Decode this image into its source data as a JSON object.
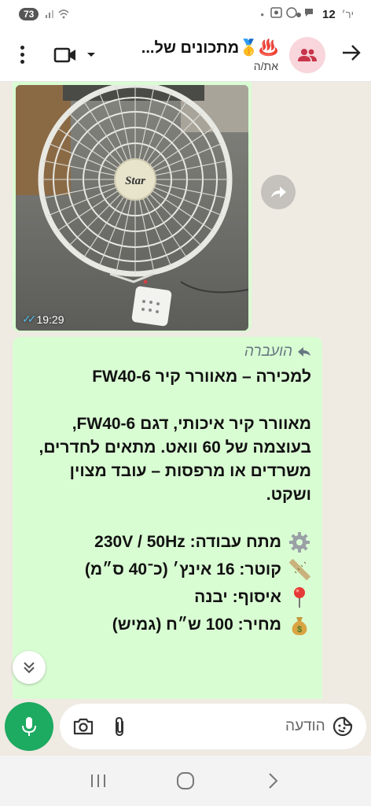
{
  "status_bar": {
    "battery": "73",
    "time": "12",
    "time_suffix": "יר׳",
    "dot": "•"
  },
  "header": {
    "title": "מתכונים של...",
    "title_emojis": "♨️🥇",
    "subtitle": "את/ה"
  },
  "image_message": {
    "time": "19:29",
    "status": "read",
    "brand_text": "Star"
  },
  "text_message": {
    "forwarded_label": "הועברה",
    "heading": "למכירה – מאוורר קיר FW40-6",
    "paragraph": "מאוורר קיר איכותי, דגם FW40-6, בעוצמה של 60 וואט. מתאים לחדרים, משרדים או מרפסות – עובד מצוין ושקט.",
    "details": [
      {
        "icon": "gear-icon",
        "text": "מתח עבודה: 230V / 50Hz"
      },
      {
        "icon": "ruler-icon",
        "text": "קוטר: 16 אינץ׳ (כ־40 ס״מ)"
      },
      {
        "icon": "pin-icon",
        "text": "איסוף: יבנה"
      },
      {
        "icon": "money-bag-icon",
        "text": "מחיר: 100 ש״ח (גמיש)"
      }
    ]
  },
  "composer": {
    "placeholder": "הודעה"
  },
  "colors": {
    "bubble": "#d9fdd3",
    "accent_green": "#1daa61",
    "read_ticks": "#53bdeb",
    "background": "#efeae2"
  }
}
